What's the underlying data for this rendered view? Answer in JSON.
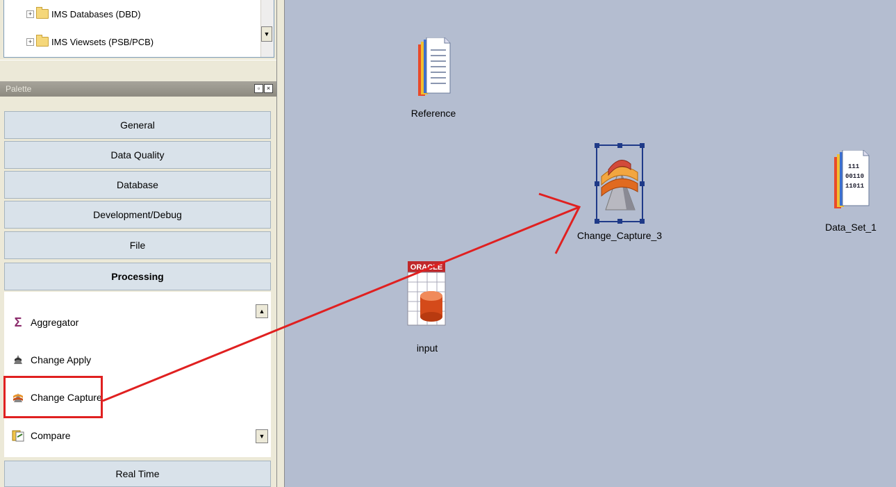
{
  "tree": {
    "items": [
      {
        "label": "IMS Databases (DBD)"
      },
      {
        "label": "IMS Viewsets (PSB/PCB)"
      }
    ]
  },
  "palette": {
    "title": "Palette",
    "categories": [
      {
        "label": "General"
      },
      {
        "label": "Data Quality"
      },
      {
        "label": "Database"
      },
      {
        "label": "Development/Debug"
      },
      {
        "label": "File"
      },
      {
        "label": "Processing",
        "active": true
      },
      {
        "label": "Real Time"
      }
    ],
    "stages": [
      {
        "label": "Aggregator",
        "icon": "sigma-icon"
      },
      {
        "label": "Change Apply",
        "icon": "change-apply-icon"
      },
      {
        "label": "Change Capture",
        "icon": "change-capture-icon"
      },
      {
        "label": "Compare",
        "icon": "compare-icon"
      }
    ]
  },
  "canvas": {
    "nodes": [
      {
        "id": "reference",
        "label": "Reference",
        "icon": "sequential-file-icon"
      },
      {
        "id": "change_capture",
        "label": "Change_Capture_3",
        "icon": "change-capture-icon",
        "selected": true
      },
      {
        "id": "data_set",
        "label": "Data_Set_1",
        "icon": "data-set-icon"
      },
      {
        "id": "input",
        "label": "input",
        "icon": "oracle-icon"
      }
    ],
    "oracle_text": "ORACLE",
    "data_set_bits": [
      "111",
      "00110",
      "11011"
    ]
  },
  "colors": {
    "canvas_bg": "#b4bdd0",
    "highlight": "#e02020",
    "selection": "#1f3a88"
  }
}
